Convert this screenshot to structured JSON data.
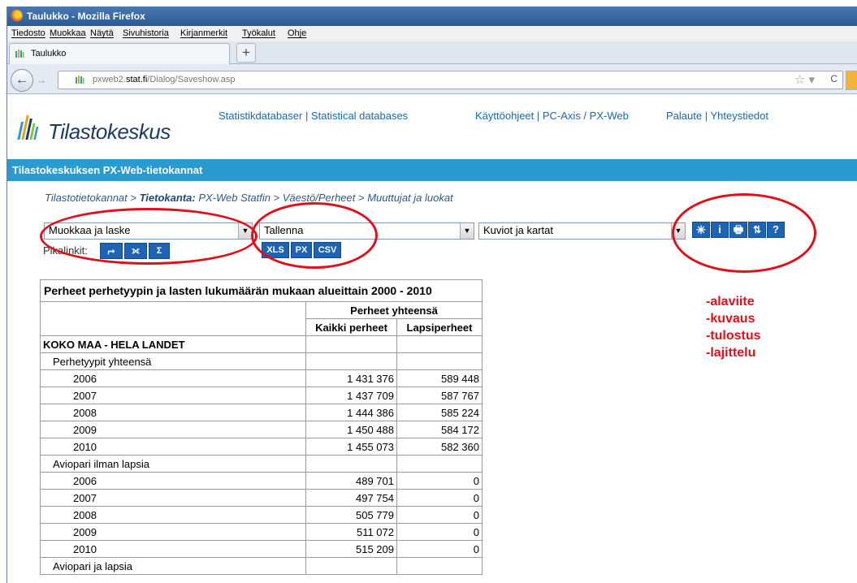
{
  "window": {
    "title": "Taulukko - Mozilla Firefox"
  },
  "menu": [
    "Tiedosto",
    "Muokkaa",
    "Näytä",
    "Sivuhistoria",
    "Kirjanmerkit",
    "Työkalut",
    "Ohje"
  ],
  "tab": {
    "title": "Taulukko",
    "new_tab": "+"
  },
  "nav": {
    "back": "←",
    "forward": "→",
    "url_host": "pxweb2.stat.fi",
    "url_prefix": "pxweb2.",
    "url_domain": "stat.fi",
    "url_path": "/Dialog/Saveshow.asp",
    "star": "☆ ▾",
    "reload": "C"
  },
  "site": {
    "logo_text": "Tilastokeskus",
    "links": [
      "Statistikdatabaser | Statistical databases",
      "Käyttöohjeet | PC-Axis / PX-Web",
      "Palaute | Yhteystiedot"
    ],
    "bar_title": "Tilastokeskuksen PX-Web-tietokannat",
    "breadcrumb": {
      "part1": "Tilastotietokannat > ",
      "bold": "Tietokanta:",
      "part2": " PX-Web Statfin > Väestö/Perheet > Muuttujat ja luokat"
    }
  },
  "toolbar": {
    "select1": "Muokkaa ja laske",
    "select2": "Tallenna",
    "select3": "Kuviot ja kartat",
    "pikalinkit": "Pikalinkit:",
    "quick_buttons": [
      "⮣",
      "⟗",
      "Σ"
    ],
    "save_buttons": [
      "XLS",
      "PX",
      "CSV"
    ],
    "tool_buttons": [
      "✳",
      "i",
      "🖶",
      "⇅",
      "?"
    ]
  },
  "table": {
    "title": "Perheet perhetyypin ja lasten lukumäärän mukaan alueittain 2000 - 2010",
    "group_header": "Perheet yhteensä",
    "col1": "Kaikki perheet",
    "col2": "Lapsiperheet",
    "rows": [
      {
        "label": "KOKO MAA - HELA LANDET",
        "level": 0,
        "v1": "",
        "v2": ""
      },
      {
        "label": "Perhetyypit yhteensä",
        "level": 1,
        "v1": "",
        "v2": ""
      },
      {
        "label": "2006",
        "level": 2,
        "v1": "1 431 376",
        "v2": "589 448"
      },
      {
        "label": "2007",
        "level": 2,
        "v1": "1 437 709",
        "v2": "587 767"
      },
      {
        "label": "2008",
        "level": 2,
        "v1": "1 444 386",
        "v2": "585 224"
      },
      {
        "label": "2009",
        "level": 2,
        "v1": "1 450 488",
        "v2": "584 172"
      },
      {
        "label": "2010",
        "level": 2,
        "v1": "1 455 073",
        "v2": "582 360"
      },
      {
        "label": "Aviopari ilman lapsia",
        "level": 1,
        "v1": "",
        "v2": ""
      },
      {
        "label": "2006",
        "level": 2,
        "v1": "489 701",
        "v2": "0"
      },
      {
        "label": "2007",
        "level": 2,
        "v1": "497 754",
        "v2": "0"
      },
      {
        "label": "2008",
        "level": 2,
        "v1": "505 779",
        "v2": "0"
      },
      {
        "label": "2009",
        "level": 2,
        "v1": "511 072",
        "v2": "0"
      },
      {
        "label": "2010",
        "level": 2,
        "v1": "515 209",
        "v2": "0"
      },
      {
        "label": "Aviopari ja lapsia",
        "level": 1,
        "v1": "",
        "v2": ""
      }
    ]
  },
  "annotations": [
    "-alaviite",
    "-kuvaus",
    "-tulostus",
    "-lajittelu"
  ],
  "colors": {
    "annotation_red": "#e0101a",
    "site_blue_bar": "#2a9bd1",
    "button_blue": "#1f63b5"
  }
}
